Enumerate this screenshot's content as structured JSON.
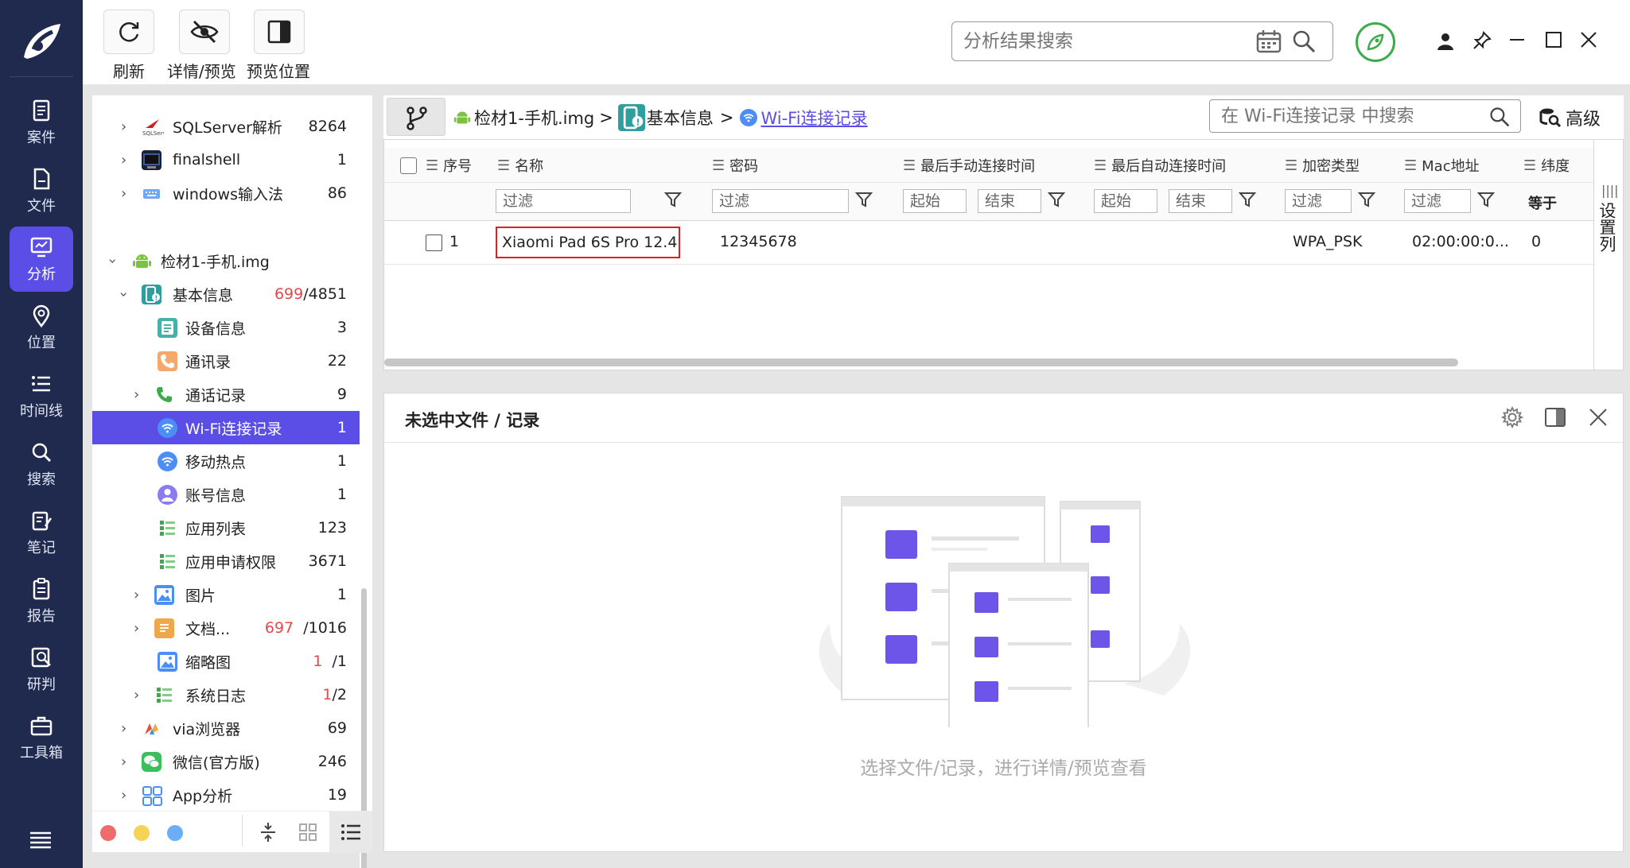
{
  "toolbar": {
    "refresh_label": "刷新",
    "detail_preview_label": "详情/预览",
    "preview_position_label": "预览位置"
  },
  "search": {
    "placeholder": "分析结果搜索"
  },
  "leftnav": {
    "items": [
      {
        "label": "案件",
        "icon": "case-icon"
      },
      {
        "label": "文件",
        "icon": "file-icon"
      },
      {
        "label": "分析",
        "icon": "analysis-icon"
      },
      {
        "label": "位置",
        "icon": "location-icon"
      },
      {
        "label": "时间线",
        "icon": "timeline-icon"
      },
      {
        "label": "搜索",
        "icon": "search-icon"
      },
      {
        "label": "笔记",
        "icon": "note-icon"
      },
      {
        "label": "报告",
        "icon": "report-icon"
      },
      {
        "label": "研判",
        "icon": "judge-icon"
      },
      {
        "label": "工具箱",
        "icon": "toolbox-icon"
      }
    ],
    "active": "分析"
  },
  "tree": {
    "items": [
      {
        "label": "SQLServer解析",
        "count": "8264"
      },
      {
        "label": "finalshell",
        "count": "1"
      },
      {
        "label": "windows输入法",
        "count": "86"
      },
      {
        "label": "检材1-手机.img",
        "count": ""
      },
      {
        "label": "基本信息",
        "count_hit": "699",
        "count_total": "/4851"
      },
      {
        "label": "设备信息",
        "count": "3"
      },
      {
        "label": "通讯录",
        "count": "22"
      },
      {
        "label": "通话记录",
        "count": "9"
      },
      {
        "label": "Wi-Fi连接记录",
        "count": "1"
      },
      {
        "label": "移动热点",
        "count": "1"
      },
      {
        "label": "账号信息",
        "count": "1"
      },
      {
        "label": "应用列表",
        "count": "123"
      },
      {
        "label": "应用申请权限",
        "count": "3671"
      },
      {
        "label": "图片",
        "count": "1"
      },
      {
        "label": "文档...",
        "count_hit": "697",
        "count_total": "/1016"
      },
      {
        "label": "缩略图",
        "count_hit": "1",
        "count_total": "/1"
      },
      {
        "label": "系统日志",
        "count_hit": "1",
        "count_total": "/2"
      },
      {
        "label": "via浏览器",
        "count": "69"
      },
      {
        "label": "微信(官方版)",
        "count": "246"
      },
      {
        "label": "App分析",
        "count": "19"
      }
    ],
    "selected": "Wi-Fi连接记录"
  },
  "breadcrumb": {
    "items": [
      "检材1-手机.img",
      "基本信息",
      "Wi-Fi连接记录"
    ],
    "sep": ">"
  },
  "record_search": {
    "placeholder": "在 Wi-Fi连接记录 中搜索"
  },
  "advanced_label": "高级",
  "table": {
    "columns": [
      "序号",
      "名称",
      "密码",
      "最后手动连接时间",
      "最后自动连接时间",
      "加密类型",
      "Mac地址",
      "纬度"
    ],
    "filter_placeholder": "过滤",
    "start_placeholder": "起始",
    "end_placeholder": "结束",
    "equals_label": "等于",
    "settings_columns_label": "设置列",
    "rows": [
      {
        "index": "1",
        "name": "Xiaomi Pad 6S Pro 12.4",
        "password": "12345678",
        "manual_time": "",
        "auto_time": "",
        "encryption": "WPA_PSK",
        "mac": "02:00:00:0...",
        "latitude": "0"
      }
    ]
  },
  "preview": {
    "title": "未选中文件 / 记录",
    "empty_text": "选择文件/记录，进行详情/预览查看"
  },
  "colors": {
    "nav_bg": "#1f2a4e",
    "accent": "#5b4ee6",
    "highlight_border": "#e02020",
    "status_green": "#3cab4a",
    "count_red": "#e04a4a"
  }
}
